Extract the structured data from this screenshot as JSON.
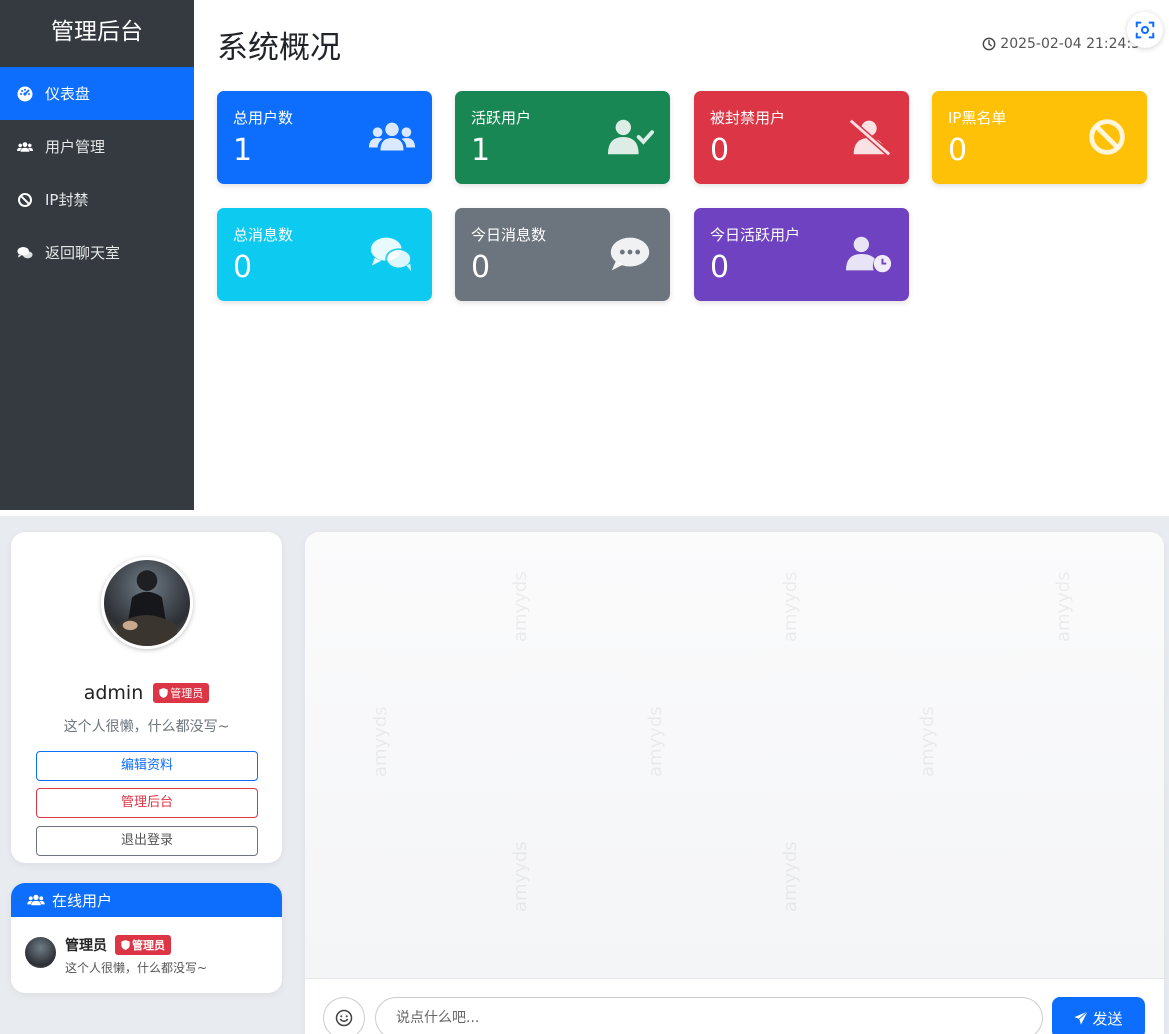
{
  "admin": {
    "sidebar": {
      "title": "管理后台",
      "items": [
        {
          "label": "仪表盘",
          "icon": "dashboard-icon",
          "active": true
        },
        {
          "label": "用户管理",
          "icon": "users-icon",
          "active": false
        },
        {
          "label": "IP封禁",
          "icon": "ban-icon",
          "active": false
        },
        {
          "label": "返回聊天室",
          "icon": "chat-icon",
          "active": false
        }
      ]
    },
    "header": {
      "title": "系统概况",
      "datetime": "2025-02-04 21:24:38"
    },
    "stats": [
      {
        "label": "总用户数",
        "value": "1",
        "color": "#0d6efd",
        "icon": "users-icon"
      },
      {
        "label": "活跃用户",
        "value": "1",
        "color": "#198754",
        "icon": "user-check-icon"
      },
      {
        "label": "被封禁用户",
        "value": "0",
        "color": "#dc3545",
        "icon": "user-slash-icon"
      },
      {
        "label": "IP黑名单",
        "value": "0",
        "color": "#ffc107",
        "icon": "ban-icon"
      },
      {
        "label": "总消息数",
        "value": "0",
        "color": "#0dcaf0",
        "icon": "comments-icon"
      },
      {
        "label": "今日消息数",
        "value": "0",
        "color": "#6c757d",
        "icon": "comment-dots-icon"
      },
      {
        "label": "今日活跃用户",
        "value": "0",
        "color": "#6f42c1",
        "icon": "user-clock-icon"
      }
    ]
  },
  "chat": {
    "profile": {
      "name": "admin",
      "badge": "管理员",
      "bio": "这个人很懒，什么都没写~",
      "buttons": {
        "edit": "编辑资料",
        "admin": "管理后台",
        "logout": "退出登录"
      }
    },
    "online": {
      "title": "在线用户",
      "users": [
        {
          "name": "管理员",
          "badge": "管理员",
          "bio": "这个人很懒，什么都没写~"
        }
      ]
    },
    "watermark": "amyyds",
    "input": {
      "placeholder": "说点什么吧...",
      "send_label": "发送"
    }
  }
}
